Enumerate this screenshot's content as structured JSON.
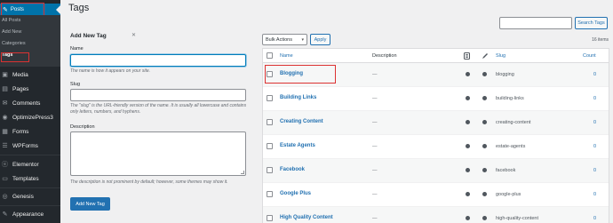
{
  "sidebar": {
    "posts_label": "Posts",
    "submenu": [
      "All Posts",
      "Add New",
      "Categories",
      "Tags"
    ],
    "items": [
      {
        "icon": "media-icon",
        "glyph": "▣",
        "label": "Media"
      },
      {
        "icon": "pages-icon",
        "glyph": "▤",
        "label": "Pages"
      },
      {
        "icon": "comments-icon",
        "glyph": "✉",
        "label": "Comments"
      },
      {
        "icon": "optimizepress-icon",
        "glyph": "◉",
        "label": "OptimizePress3"
      },
      {
        "icon": "forms-icon",
        "glyph": "▦",
        "label": "Forms"
      },
      {
        "icon": "wpforms-icon",
        "glyph": "☰",
        "label": "WPForms"
      },
      {
        "icon": "elementor-icon",
        "glyph": "ⓔ",
        "label": "Elementor"
      },
      {
        "icon": "templates-icon",
        "glyph": "▭",
        "label": "Templates"
      },
      {
        "icon": "genesis-icon",
        "glyph": "◎",
        "label": "Genesis"
      },
      {
        "icon": "appearance-icon",
        "glyph": "✎",
        "label": "Appearance"
      }
    ]
  },
  "header": {
    "title": "Tags",
    "search_button": "Search Tags"
  },
  "form": {
    "title": "Add New Tag",
    "name_label": "Name",
    "name_help": "The name is how it appears on your site.",
    "slug_label": "Slug",
    "slug_help": "The \"slug\" is the URL-friendly version of the name. It is usually all lowercase and contains only letters, numbers, and hyphens.",
    "description_label": "Description",
    "description_help": "The description is not prominent by default; however, some themes may show it.",
    "submit_label": "Add New Tag"
  },
  "bulk": {
    "select_value": "Bulk Actions",
    "apply_label": "Apply",
    "items_count": "16 items"
  },
  "table": {
    "columns": {
      "name": "Name",
      "description": "Description",
      "slug": "Slug",
      "count": "Count"
    },
    "rows": [
      {
        "name": "Blogging",
        "description": "—",
        "slug": "blogging",
        "count": "0"
      },
      {
        "name": "Building Links",
        "description": "—",
        "slug": "building-links",
        "count": "0"
      },
      {
        "name": "Creating Content",
        "description": "—",
        "slug": "creating-content",
        "count": "0"
      },
      {
        "name": "Estate Agents",
        "description": "—",
        "slug": "estate-agents",
        "count": "0"
      },
      {
        "name": "Facebook",
        "description": "—",
        "slug": "facebook",
        "count": "0"
      },
      {
        "name": "Google Plus",
        "description": "—",
        "slug": "google-plus",
        "count": "0"
      },
      {
        "name": "High Quality Content",
        "description": "—",
        "slug": "high-quality-content",
        "count": "0"
      }
    ]
  },
  "colors": {
    "sidebar_bg": "#23282d",
    "active_menu": "#0073aa",
    "link": "#2271b1",
    "highlight_box": "#dc3232"
  }
}
